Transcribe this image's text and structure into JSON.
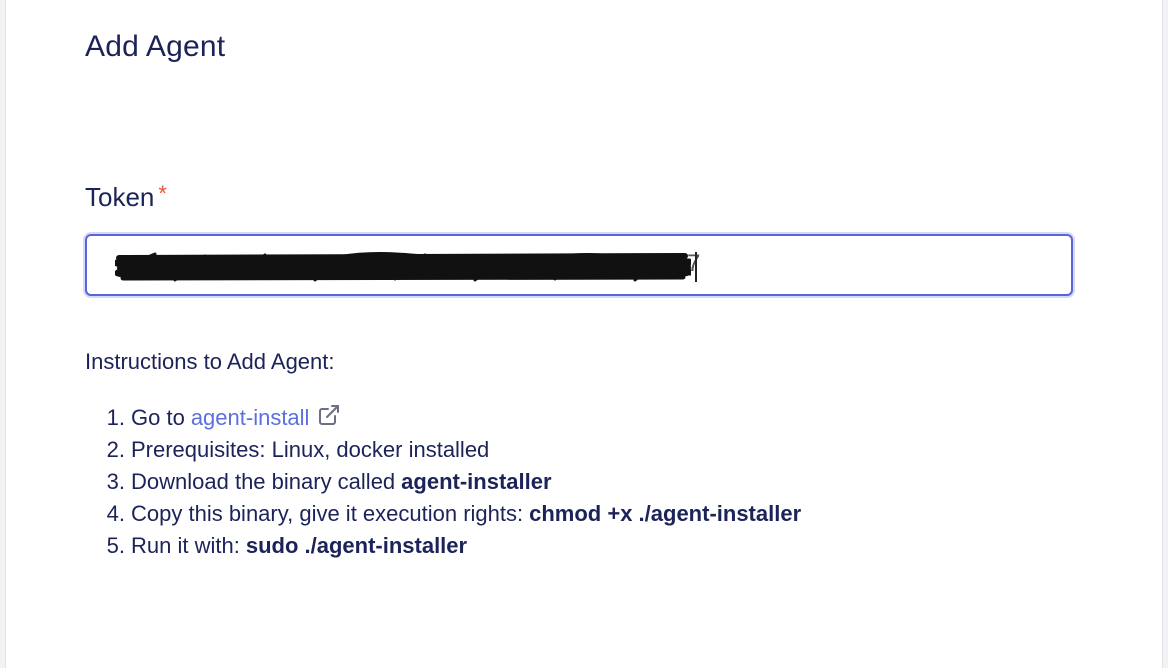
{
  "dialog": {
    "title": "Add Agent"
  },
  "token_field": {
    "label": "Token",
    "required_marker": "*",
    "value_visible_tail": "7"
  },
  "instructions": {
    "heading": "Instructions to Add Agent:",
    "steps": [
      {
        "num": "1.",
        "prefix": "Go to",
        "link": "agent-install",
        "icon": "external-link-icon"
      },
      {
        "num": "2.",
        "text": "Prerequisites: Linux, docker installed"
      },
      {
        "num": "3.",
        "prefix": "Download the binary called",
        "bold": "agent-installer"
      },
      {
        "num": "4.",
        "prefix": "Copy this binary, give it execution rights:",
        "bold": "chmod +x ./agent-installer"
      },
      {
        "num": "5.",
        "prefix": "Run it with:",
        "bold": "sudo ./agent-installer"
      }
    ]
  },
  "colors": {
    "text": "#1c2358",
    "accent": "#5a63d8",
    "link": "#5b6fe0",
    "required": "#e8543a"
  }
}
